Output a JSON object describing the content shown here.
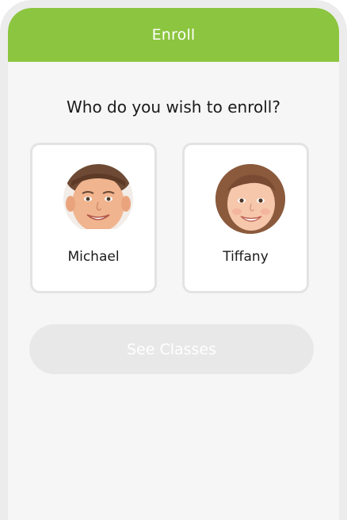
{
  "header": {
    "title": "Enroll",
    "color": "#8cc53f"
  },
  "prompt": {
    "question": "Who do you wish to enroll?"
  },
  "children": [
    {
      "name": "Michael",
      "avatar": "child-photo-michael"
    },
    {
      "name": "Tiffany",
      "avatar": "child-photo-tiffany"
    }
  ],
  "actions": {
    "see_classes_label": "See Classes",
    "see_classes_state": "disabled"
  }
}
